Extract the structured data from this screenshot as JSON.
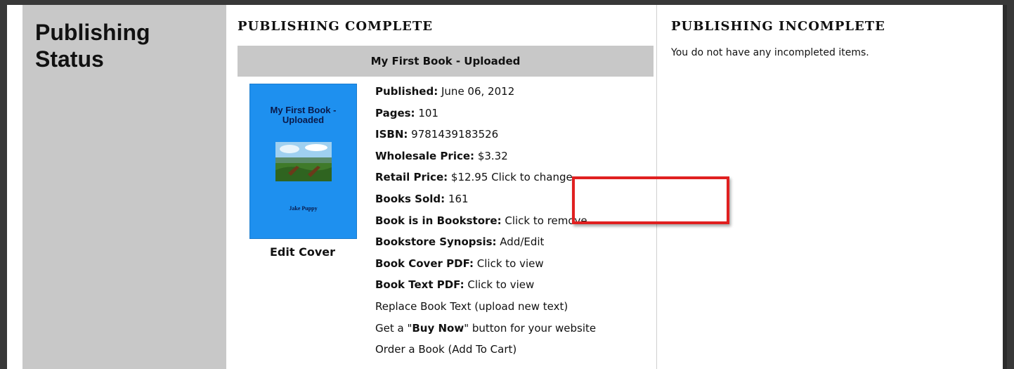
{
  "sidebar": {
    "title": "Publishing Status"
  },
  "complete": {
    "heading": "PUBLISHING COMPLETE",
    "book_bar": "My First Book - Uploaded",
    "cover": {
      "title": "My First Book - Uploaded",
      "author": "Jake Puppy",
      "image_icon": "landscape-with-chairs",
      "color": "#1e90ef"
    },
    "edit_cover": "Edit Cover",
    "details": {
      "published_label": "Published:",
      "published_value": "June 06, 2012",
      "pages_label": "Pages:",
      "pages_value": "101",
      "isbn_label": "ISBN:",
      "isbn_value": "9781439183526",
      "wholesale_label": "Wholesale Price:",
      "wholesale_value": "$3.32",
      "retail_label": "Retail Price:",
      "retail_value": "$12.95",
      "retail_link": "Click to change",
      "sold_label": "Books Sold:",
      "sold_value": "161",
      "bookstore_label": "Book is in Bookstore:",
      "bookstore_link": "Click to remove",
      "synopsis_label": "Bookstore Synopsis:",
      "synopsis_link": "Add/Edit",
      "cover_pdf_label": "Book Cover PDF:",
      "cover_pdf_link": "Click to view",
      "text_pdf_label": "Book Text PDF:",
      "text_pdf_link": "Click to view",
      "replace_text": "Replace Book Text (upload new text)",
      "buy_now_pre": "Get a \"",
      "buy_now_bold": "Buy Now",
      "buy_now_post": "\" button for your website",
      "order_book": "Order a Book (Add To Cart)"
    },
    "highlight_color": "#e02020"
  },
  "incomplete": {
    "heading": "PUBLISHING INCOMPLETE",
    "message": "You do not have any incompleted items."
  }
}
